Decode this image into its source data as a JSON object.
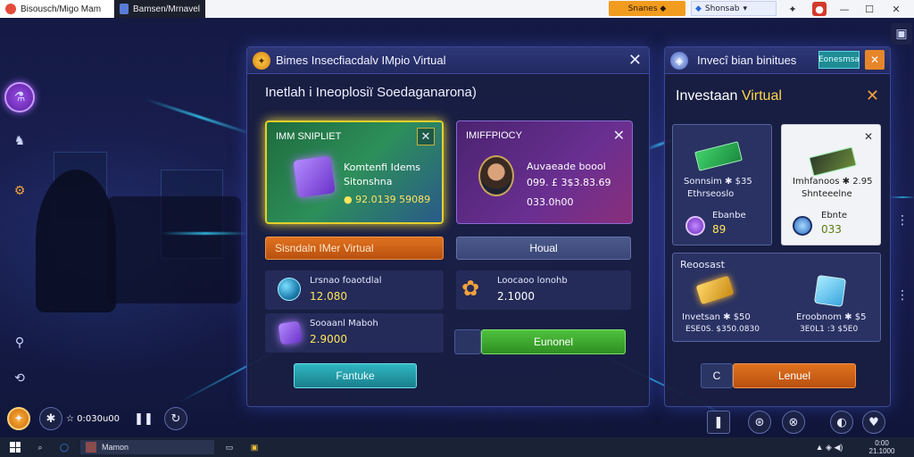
{
  "browser": {
    "tab1_title": "Bisousch/Migo Mam",
    "tab2_title": "Bamsen/Mrnavel",
    "orange_pill": "Snanes",
    "blue_pill": "Shonsab"
  },
  "main_panel": {
    "title": "Bimes Insecfiacdalv IMpio Virtual",
    "subheading": "Inetlah i Ineoplosiï Soedaganarona)",
    "card_left": {
      "tag": "IMM SNIPLIET",
      "name_line1": "Komtenfi Idems",
      "name_line2": "Sitonshna",
      "price": "● 92.0139 59089"
    },
    "card_right": {
      "tag": "IMIFFPIOCY",
      "name_line1": "Auvaeade boool",
      "name_line2": "099. £ 3$3.83.69",
      "price": "033.0h00"
    },
    "buttons": {
      "left_action": "Sisndaln IMer Virtual",
      "right_action": "Houal",
      "green_action": "Eunonel",
      "teal_action": "Fantuke"
    },
    "rows": [
      {
        "label": "Lrsnao foaotdlal",
        "value": "12.080"
      },
      {
        "label": "Loocaoo lonohb",
        "value": "2.1000"
      },
      {
        "label": "Sooaanl Maboh",
        "value": "2.9000"
      }
    ]
  },
  "side_panel": {
    "title": "Invecî bian binitues",
    "tag": "Eonesmsa",
    "heading_prefix": "Investaan",
    "heading_accent": "Virtual",
    "mini_left": {
      "line1": "Sonnsim ✱ $35",
      "line2": "Ethrseoslo",
      "coin_label": "Ebanbe",
      "coin_value": "89"
    },
    "mini_right": {
      "line1": "Imhfanoos ✱ 2.95",
      "line2": "Shnteeelne",
      "coin_label": "Ebnte",
      "coin_value": "033"
    },
    "section_label": "Reoosast",
    "item_left": {
      "line1": "Invetsan ✱ $50",
      "line2": "ESE0S. $350.0830"
    },
    "item_right": {
      "line1": "Eroobnom ✱ $5",
      "line2": "3E0L1 :3 $5E0"
    },
    "buttons": {
      "small": "C",
      "main": "Lenuel"
    }
  },
  "hud": {
    "timer": "☆ 0:030u00"
  },
  "taskbar": {
    "app_label": "Mamon",
    "clock_time": "0:00",
    "clock_date": "21.1000"
  }
}
